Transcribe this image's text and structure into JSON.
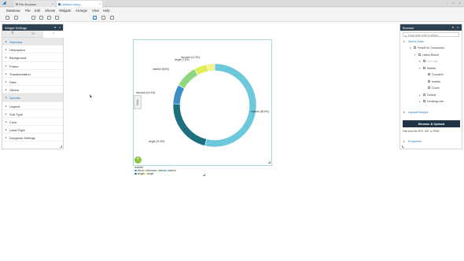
{
  "tabs": [
    {
      "label": "File Browser",
      "active": false
    },
    {
      "label": "Untitled Infog...",
      "active": true
    }
  ],
  "menu": [
    "Datamaw",
    "File",
    "Edit",
    "Sheets",
    "Widgets",
    "Arrange",
    "View",
    "Help"
  ],
  "left_panel": {
    "title": "Widget Settings",
    "tab_icons": [
      "text-icon",
      "image-icon",
      "chart-settings-icon"
    ],
    "rows": [
      {
        "label": "Standard",
        "highlight": true
      },
      {
        "label": "Description",
        "highlight": false
      },
      {
        "label": "Background",
        "highlight": false
      },
      {
        "label": "Frame",
        "highlight": false
      },
      {
        "label": "Transformation",
        "highlight": false
      },
      {
        "label": "Data",
        "highlight": false
      },
      {
        "label": "Others",
        "highlight": false
      },
      {
        "label": "Specific",
        "highlight": true
      },
      {
        "label": "Legend",
        "highlight": false
      },
      {
        "label": "Sub-Type",
        "highlight": false
      },
      {
        "label": "Color",
        "highlight": false
      },
      {
        "label": "Label Style",
        "highlight": false
      },
      {
        "label": "Doughnut Settings",
        "highlight": false
      }
    ]
  },
  "widget": {
    "side_tab": "Data",
    "add_button": "+"
  },
  "chart_data": {
    "type": "pie",
    "subtype": "doughnut",
    "legend_title": "marital",
    "labels": [
      "married (53.8%)",
      "single (21.8%)",
      "divorced (10.4%)",
      "married (8.8%)",
      "single (7.5%)",
      "divorced (11.3%)"
    ],
    "slices": [
      {
        "name": "married",
        "percent": 53.8,
        "color": "#6cc8db"
      },
      {
        "name": "single",
        "percent": 21.8,
        "color": "#1b6f7f"
      },
      {
        "name": "divorced",
        "percent": 7.5,
        "color": "#3d8fc7"
      },
      {
        "name": "married",
        "percent": 8.8,
        "color": "#8ed67f"
      },
      {
        "name": "single",
        "percent": 5.1,
        "color": "#e2ee58"
      },
      {
        "name": "divorced",
        "percent": 3.0,
        "color": "#f4f08c"
      }
    ],
    "legend": [
      {
        "label": "divorced",
        "color": "#3d8fc7"
      },
      {
        "label": "divorced",
        "color": "#f4f08c"
      },
      {
        "label": "married",
        "color": "#8ed67f"
      },
      {
        "label": "married",
        "color": "#6cc8db"
      },
      {
        "label": "single",
        "color": "#1b6f7f"
      },
      {
        "label": "single",
        "color": "#e2ee58"
      }
    ]
  },
  "right_panel": {
    "title": "Browser",
    "search_placeholder": "Drag data onto a widget",
    "select_data": "Select Data",
    "tree": [
      {
        "label": "Result for Successful",
        "indent": 0,
        "arrow": "▾"
      },
      {
        "label": "Latest Result",
        "indent": 1,
        "arrow": "▾"
      },
      {
        "label": "Item Age",
        "indent": 2,
        "arrow": "▸",
        "dim": true
      },
      {
        "label": "Marital",
        "indent": 2,
        "arrow": "▾"
      },
      {
        "label": "Counter0",
        "indent": 3,
        "arrow": ""
      },
      {
        "label": "marital",
        "indent": 3,
        "arrow": ""
      },
      {
        "label": "Count",
        "indent": 3,
        "arrow": ""
      },
      {
        "label": "Default",
        "indent": 2,
        "arrow": "▸"
      },
      {
        "label": "HousingLoan",
        "indent": 2,
        "arrow": "▸"
      }
    ],
    "upload_images": "Upload Images",
    "browse_button": "Browse & Upload",
    "upload_hint": "File must be JPG, GIF, or PNG",
    "properties": "Properties"
  }
}
